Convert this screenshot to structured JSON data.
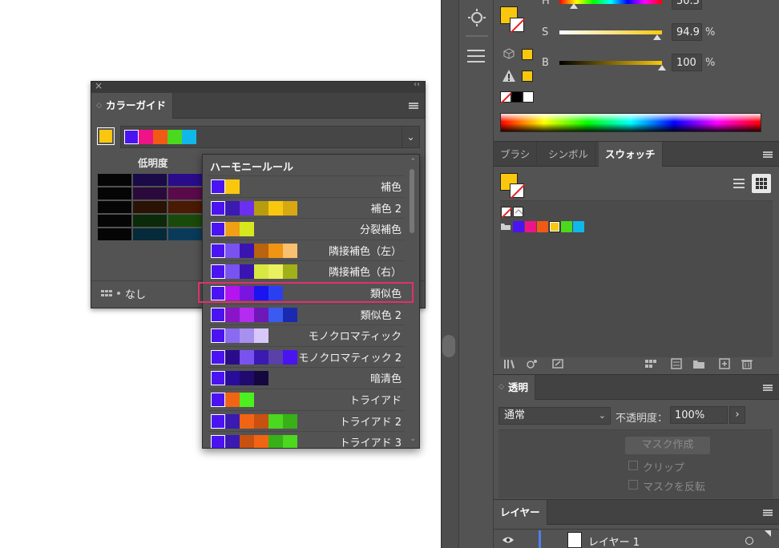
{
  "color_panel": {
    "h_label": "H",
    "h_value": "50.5",
    "s_label": "S",
    "s_value": "94.9",
    "s_unit": "%",
    "b_label": "B",
    "b_value": "100",
    "b_unit": "%"
  },
  "swatch_tabs": {
    "brush": "ブラシ",
    "symbol": "シンボル",
    "swatches": "スウォッチ"
  },
  "transparency": {
    "tab": "透明",
    "mode": "通常",
    "opacity_label": "不透明度：",
    "opacity_value": "100%",
    "make_mask": "マスク作成",
    "clip": "クリップ",
    "invert_mask": "マスクを反転"
  },
  "layers": {
    "tab": "レイヤー",
    "layer_name": "レイヤー 1"
  },
  "color_guide": {
    "tab": "カラーガイド",
    "low_brightness": "低明度",
    "none_label": "なし",
    "base_color": "#f9c80e",
    "harmony_colors": [
      "#4a14f0",
      "#ee1487",
      "#f05a14",
      "#4bd81e",
      "#0fb8e8"
    ]
  },
  "harmony": {
    "title": "ハーモニールール",
    "rules": [
      {
        "name": "補色",
        "colors": [
          "#4a14f0",
          "#f9c80e"
        ]
      },
      {
        "name": "補色 2",
        "colors": [
          "#4a14f0",
          "#3a1ab0",
          "#6b2ff0",
          "#b89c10",
          "#f9c80e",
          "#d8a812"
        ]
      },
      {
        "name": "分裂補色",
        "colors": [
          "#4a14f0",
          "#f0a014",
          "#d8e81e"
        ]
      },
      {
        "name": "隣接補色（左）",
        "colors": [
          "#4a14f0",
          "#7a52f0",
          "#3a14b0",
          "#b86410",
          "#f09414",
          "#f8c070"
        ]
      },
      {
        "name": "隣接補色（右）",
        "colors": [
          "#4a14f0",
          "#7a52f0",
          "#3a14b0",
          "#d8e840",
          "#eaf060",
          "#a0b018"
        ]
      },
      {
        "name": "類似色",
        "colors": [
          "#4a14f0",
          "#b414f0",
          "#7a14e0",
          "#1a14f0",
          "#2a40f0"
        ]
      },
      {
        "name": "類似色 2",
        "colors": [
          "#4a14f0",
          "#8a14c8",
          "#b42cf0",
          "#6e18b8",
          "#3a5af0",
          "#1a2ab0"
        ]
      },
      {
        "name": "モノクロマティック",
        "colors": [
          "#4a14f0",
          "#8a6af0",
          "#a890f0",
          "#d8c8fa"
        ]
      },
      {
        "name": "モノクロマティック 2",
        "colors": [
          "#4a14f0",
          "#2a0c8a",
          "#7a52f0",
          "#3a1ab0",
          "#5a40a8",
          "#4a14f0"
        ]
      },
      {
        "name": "暗清色",
        "colors": [
          "#4a14f0",
          "#2a0c9a",
          "#200a70",
          "#14063e"
        ]
      },
      {
        "name": "トライアド",
        "colors": [
          "#4a14f0",
          "#f06414",
          "#4bf01e"
        ]
      },
      {
        "name": "トライアド 2",
        "colors": [
          "#4a14f0",
          "#3a1ab0",
          "#f06414",
          "#c85010",
          "#4bd81e",
          "#38b018"
        ]
      },
      {
        "name": "トライアド 3",
        "colors": [
          "#4a14f0",
          "#3a1ab0",
          "#c85010",
          "#f06414",
          "#38b018",
          "#4bd81e"
        ]
      }
    ]
  },
  "swatch_row": [
    "#4a14f0",
    "#ee1487",
    "#f05a14",
    "#f9c80e",
    "#4bd81e",
    "#0fb8e8"
  ],
  "accent_highlight": "#e0306e"
}
